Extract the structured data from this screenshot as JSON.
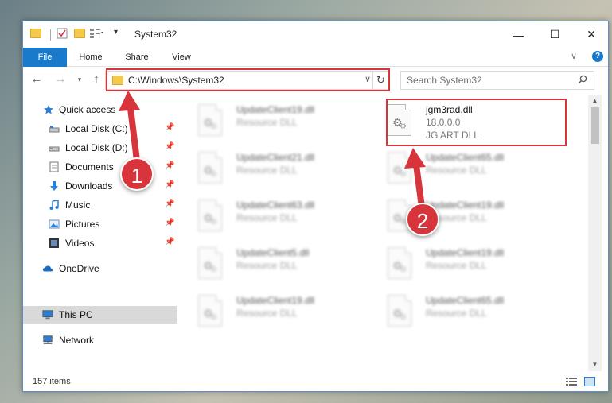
{
  "window": {
    "title": "System32",
    "controls": {
      "minimize": "—",
      "maximize": "☐",
      "close": "✕"
    }
  },
  "ribbon": {
    "tabs": [
      {
        "label": "File",
        "active": true
      },
      {
        "label": "Home"
      },
      {
        "label": "Share"
      },
      {
        "label": "View"
      }
    ],
    "expand_glyph": "∨",
    "help_glyph": "?"
  },
  "address": {
    "path": "C:\\Windows\\System32",
    "search_placeholder": "Search System32"
  },
  "navpane": {
    "items": [
      {
        "label": "Quick access",
        "icon": "star-icon"
      },
      {
        "label": "Local Disk (C:)",
        "icon": "drive-icon",
        "pinned": true
      },
      {
        "label": "Local Disk (D:)",
        "icon": "drive-icon",
        "pinned": true
      },
      {
        "label": "Documents",
        "icon": "documents-icon",
        "pinned": true
      },
      {
        "label": "Downloads",
        "icon": "download-icon",
        "pinned": true
      },
      {
        "label": "Music",
        "icon": "music-icon",
        "pinned": true
      },
      {
        "label": "Pictures",
        "icon": "pictures-icon",
        "pinned": true
      },
      {
        "label": "Videos",
        "icon": "videos-icon",
        "pinned": true
      },
      {
        "label": "OneDrive",
        "icon": "cloud-icon"
      },
      {
        "label": "This PC",
        "icon": "computer-icon",
        "selected": true
      },
      {
        "label": "Network",
        "icon": "network-icon"
      }
    ]
  },
  "files": [
    {
      "name": "UpdateClient19.dll",
      "type": "Resource DLL"
    },
    {
      "name": "jgm3rad.dll",
      "version": "18.0.0.0",
      "type": "JG ART DLL",
      "highlighted": true
    },
    {
      "name": "UpdateClient21.dll",
      "type": "Resource DLL"
    },
    {
      "name": "UpdateClient65.dll",
      "type": "Resource DLL"
    },
    {
      "name": "UpdateClient63.dll",
      "type": "Resource DLL"
    },
    {
      "name": "UpdateClient19.dll",
      "type": "Resource DLL"
    },
    {
      "name": "UpdateClient5.dll",
      "type": "Resource DLL"
    },
    {
      "name": "UpdateClient19.dll",
      "type": "Resource DLL"
    },
    {
      "name": "UpdateClient19.dll",
      "type": "Resource DLL"
    },
    {
      "name": "UpdateClient65.dll",
      "type": "Resource DLL"
    }
  ],
  "status": {
    "item_count": "157 items"
  },
  "annotations": [
    {
      "number": "1"
    },
    {
      "number": "2"
    }
  ],
  "colors": {
    "accent": "#1979ca",
    "highlight": "#d8343c",
    "folder": "#f3c94e"
  }
}
